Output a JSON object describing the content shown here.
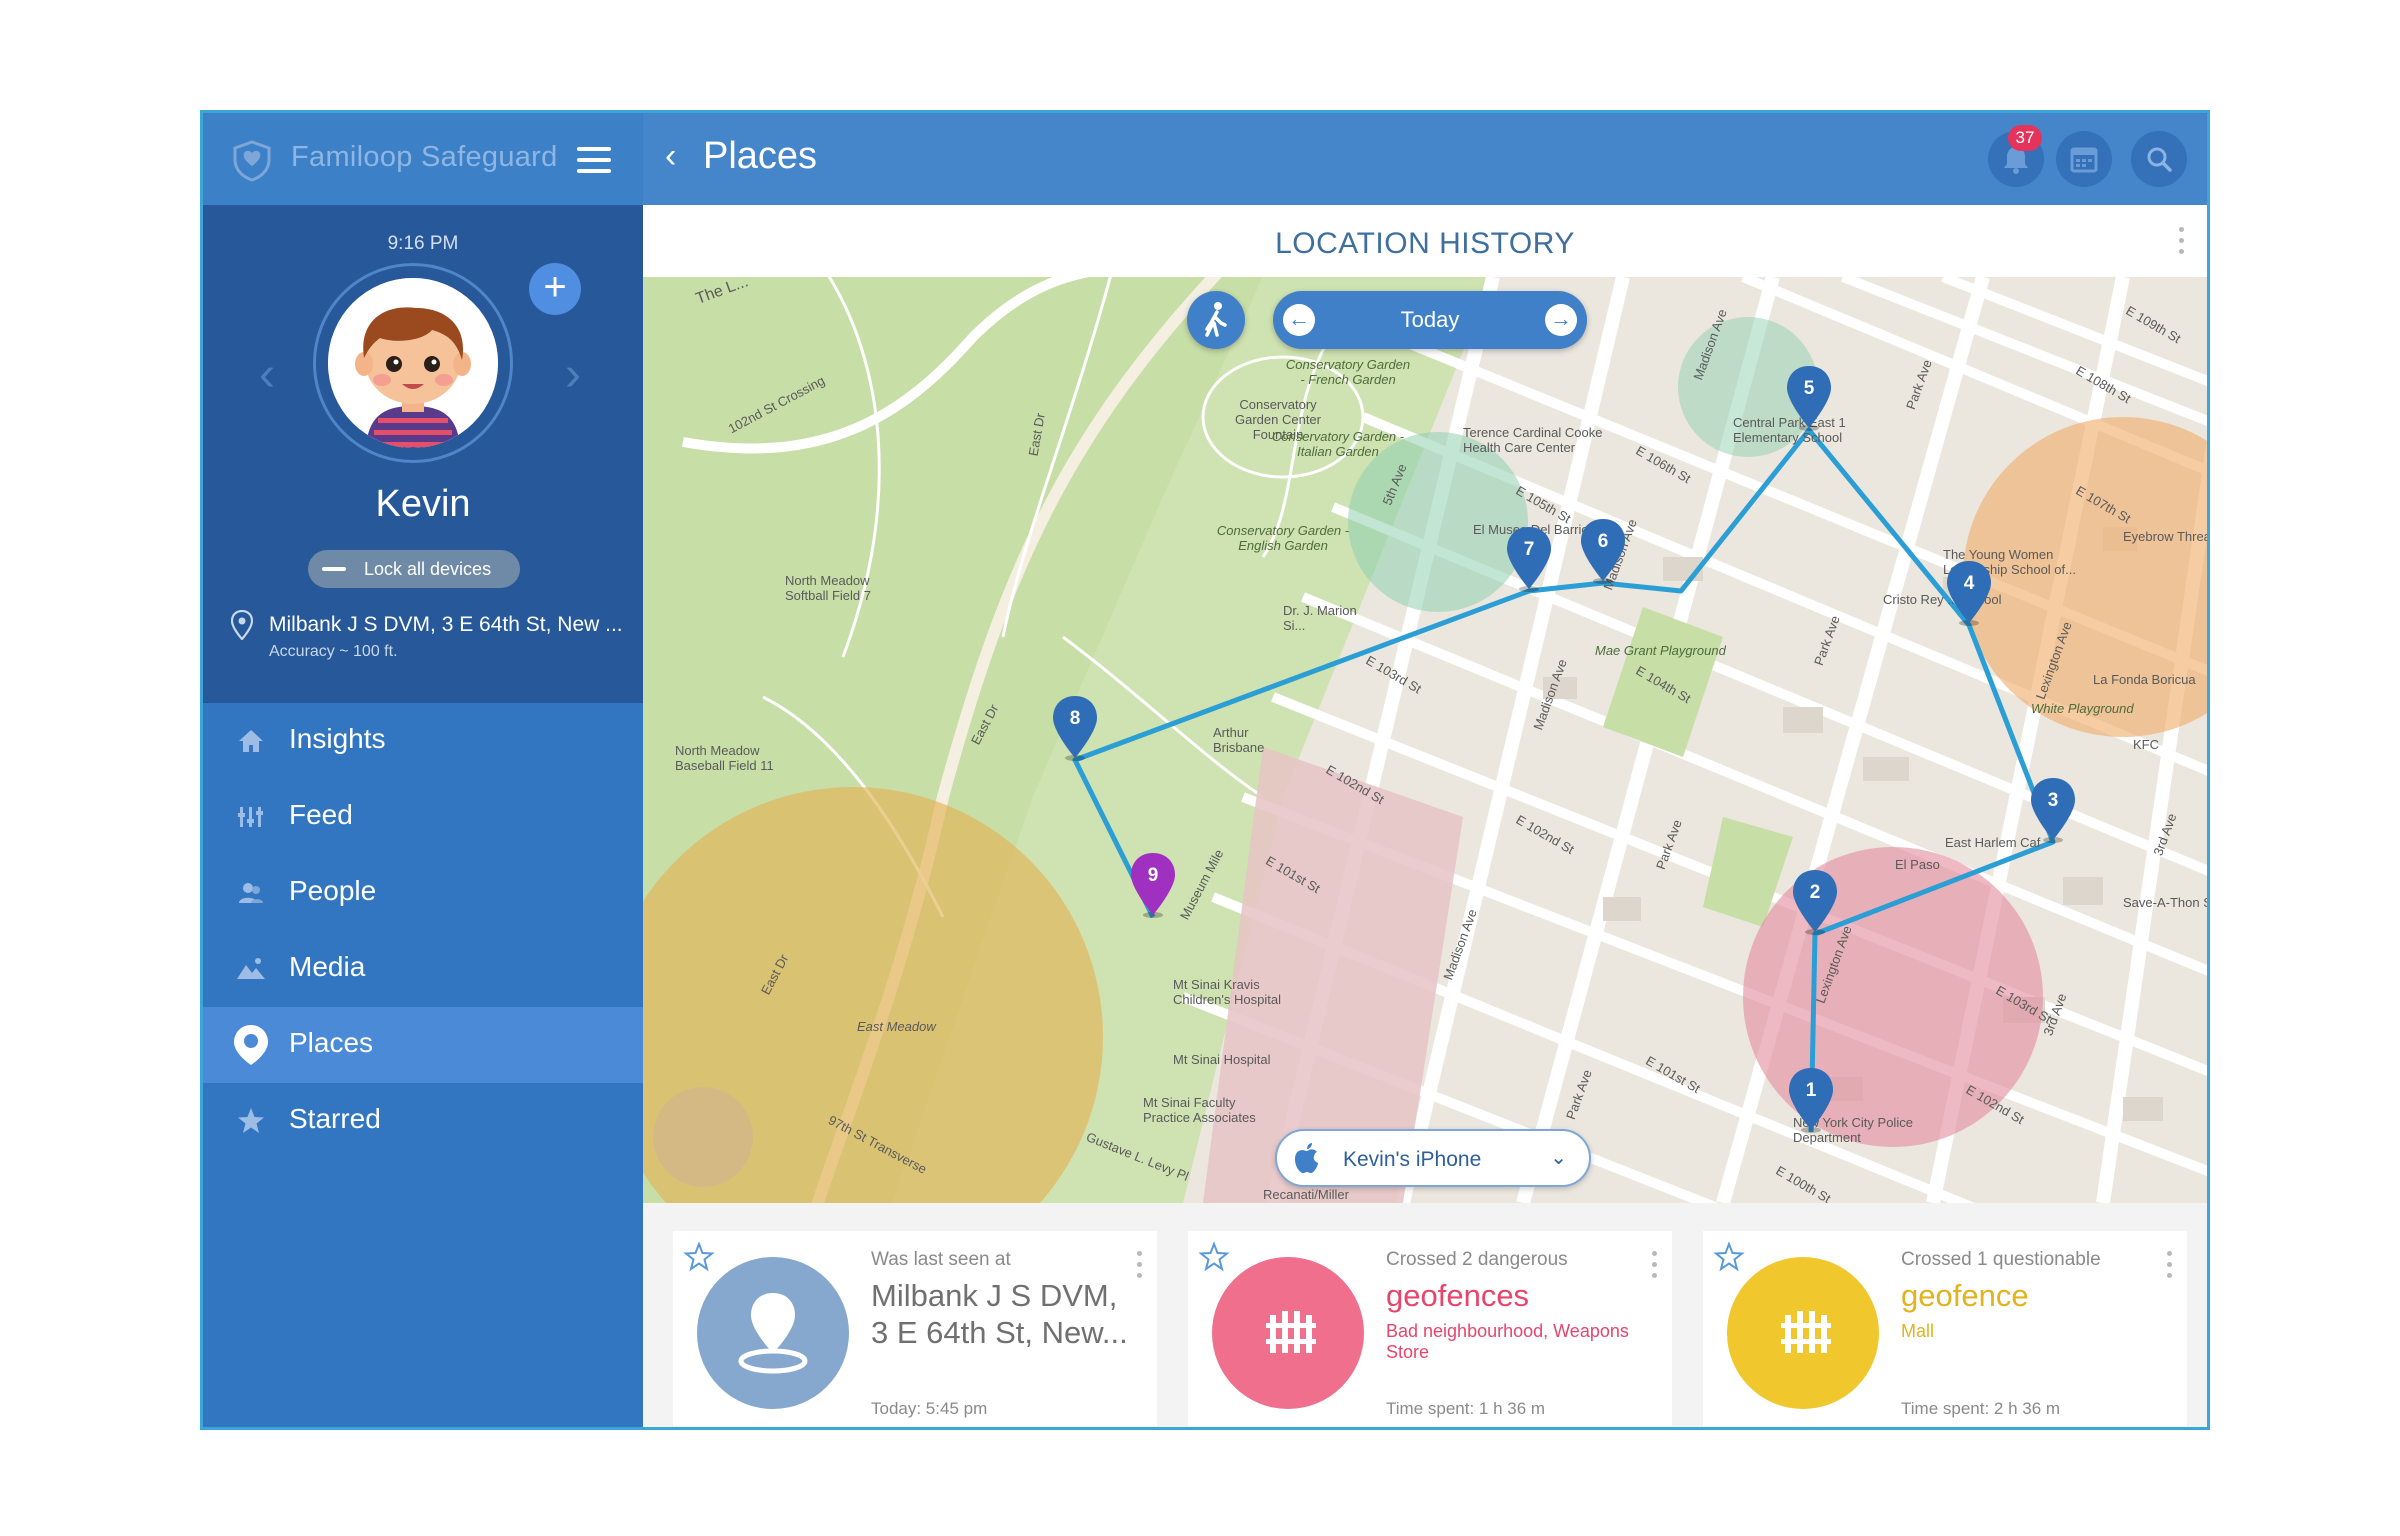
{
  "app": {
    "name": "Familoop Safeguard"
  },
  "sidebar": {
    "time": "9:16 PM",
    "kid_name": "Kevin",
    "lock_label": "Lock all devices",
    "location": "Milbank J S DVM, 3 E 64th St, New ...",
    "accuracy": "Accuracy ~ 100 ft.",
    "nav": [
      {
        "label": "Insights",
        "icon": "home-icon"
      },
      {
        "label": "Feed",
        "icon": "feed-icon"
      },
      {
        "label": "People",
        "icon": "people-icon"
      },
      {
        "label": "Media",
        "icon": "media-icon"
      },
      {
        "label": "Places",
        "icon": "places-icon",
        "active": true
      },
      {
        "label": "Starred",
        "icon": "star-icon"
      }
    ]
  },
  "topbar": {
    "title": "Places",
    "notifications_count": "37"
  },
  "content": {
    "section_title": "LOCATION HISTORY"
  },
  "map": {
    "date_label": "Today",
    "device_label": "Kevin's iPhone",
    "markers": [
      "1",
      "2",
      "3",
      "4",
      "5",
      "6",
      "7",
      "8",
      "9"
    ],
    "labels": {
      "cons_french": "Conservatory Garden - French Garden",
      "cons_center": "Conservatory Garden Center Fountain",
      "cons_italian": "Conservatory Garden - Italian Garden",
      "cons_english": "Conservatory Garden - English Garden",
      "terence": "Terence Cardinal Cooke Health Care Center",
      "museo": "El Museo Del Barrio",
      "central_park_east": "Central Park East 1 Elementary School",
      "young_women": "The Young Women Leadership School of...",
      "cristo_rey": "Cristo Rey ... School",
      "eyebrow": "Eyebrow Threadi",
      "la_fonda": "La Fonda Boricua",
      "white_playground": "White Playground",
      "kfc": "KFC",
      "east_harlem": "East Harlem Caf",
      "el_paso": "El Paso",
      "save_a_thon": "Save-A-Thon S",
      "mae_grant": "Mae Grant Playground",
      "north_meadow_7": "North Meadow Softball Field 7",
      "north_meadow_11": "North Meadow Baseball Field 11",
      "east_meadow": "East Meadow",
      "arthur_brisbane": "Arthur Brisbane",
      "marion": "Dr. J. Marion Si...",
      "mt_sinai_kravis": "Mt Sinai Kravis Children's Hospital",
      "mt_sinai_hospital": "Mt Sinai Hospital",
      "mt_sinai_faculty": "Mt Sinai Faculty Practice Associates",
      "nyc_police": "New York City Police Department",
      "recanati": "Recanati/Miller",
      "museum_mile": "Museum Mile",
      "the_loch": "The L...",
      "st_102_crossing": "102nd St Crossing",
      "east_dr": "East Dr",
      "east_dr_2": "East Dr",
      "east_dr_3": "East Dr",
      "transverse": "97th St Transverse",
      "gustave": "Gustave L. Levy Pl",
      "fifth_ave": "5th Ave",
      "madison_1": "Madison Ave",
      "madison_2": "Madison Ave",
      "madison_3": "Madison Ave",
      "madison_4": "Madison Ave",
      "park_1": "Park Ave",
      "park_2": "Park Ave",
      "park_3": "Park Ave",
      "park_4": "Park Ave",
      "lexington_1": "Lexington Ave",
      "lexington_2": "Lexington Ave",
      "third_ave": "3rd Ave",
      "third_ave_2": "3rd Ave",
      "e107": "E 107th St",
      "e108": "E 108th St",
      "e109": "E 109th St",
      "e106": "E 106th St",
      "e105": "E 105th St",
      "e104": "E 104th St",
      "e103": "E 103rd St",
      "e102": "E 102nd St",
      "e101": "E 101st St",
      "e100": "E 100th St",
      "e102nd_st_left": "E 102nd St",
      "e103rd_left": "E 103rd St",
      "e101st_left": "E 101st St",
      "e102nd_dr": "E 102nd St"
    }
  },
  "cards": [
    {
      "pre": "Was last seen at",
      "big": "Milbank J S DVM, 3 E 64th St, New...",
      "sub": "",
      "foot": "Today: 5:45 pm",
      "color": "#86a8cf"
    },
    {
      "pre": "Crossed 2 dangerous",
      "big": "geofences",
      "sub": "Bad neighbourhood, Weapons Store",
      "foot": "Time spent: 1 h 36 m",
      "color": "#ef6f8d"
    },
    {
      "pre": "Crossed 1 questionable",
      "big": "geofence",
      "sub": "Mall",
      "foot": "Time spent: 2 h 36 m",
      "color": "#f0c72c"
    }
  ]
}
